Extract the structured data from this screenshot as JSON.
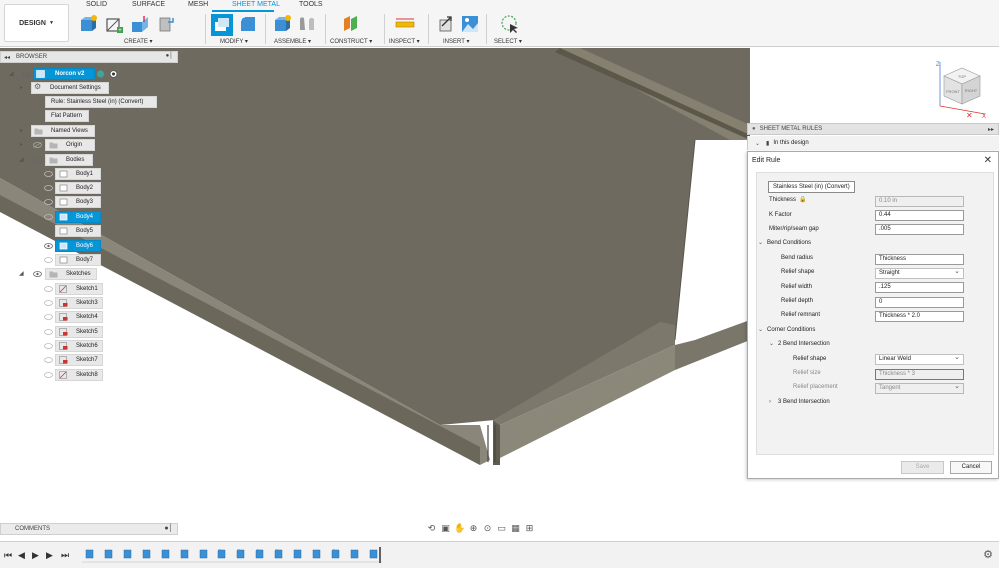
{
  "toolbar": {
    "design_label": "DESIGN",
    "tabs": [
      "SOLID",
      "SURFACE",
      "MESH",
      "SHEET METAL",
      "TOOLS"
    ],
    "groups": [
      "CREATE ▾",
      "MODIFY ▾",
      "ASSEMBLE ▾",
      "CONSTRUCT ▾",
      "INSPECT ▾",
      "INSERT ▾",
      "SELECT ▾"
    ]
  },
  "browser": {
    "title": "BROWSER",
    "root": "Norcon v2",
    "items": [
      {
        "label": "Document Settings"
      },
      {
        "label": "Rule: Stainless Steel (in) (Convert)"
      },
      {
        "label": "Flat Pattern"
      },
      {
        "label": "Named Views"
      },
      {
        "label": "Origin"
      },
      {
        "label": "Bodies"
      }
    ],
    "bodies": [
      "Body1",
      "Body2",
      "Body3",
      "Body4",
      "Body5",
      "Body6",
      "Body7"
    ],
    "sketches_label": "Sketches",
    "sketches": [
      "Sketch1",
      "Sketch3",
      "Sketch4",
      "Sketch5",
      "Sketch6",
      "Sketch7",
      "Sketch8"
    ]
  },
  "comments": {
    "label": "COMMENTS"
  },
  "sheet_metal_rules": {
    "title": "SHEET METAL RULES",
    "section": "In this design"
  },
  "edit_rule": {
    "title": "Edit Rule",
    "rule_name": "Stainless Steel (in) (Convert)",
    "thickness_label": "Thickness",
    "thickness_value": "0.10 in",
    "kfactor_label": "K Factor",
    "kfactor_value": "0.44",
    "gap_label": "Miter/rip/seam gap",
    "gap_value": ".005",
    "bend_conditions": "Bend Conditions",
    "bend_radius_label": "Bend radius",
    "bend_radius_value": "Thickness",
    "relief_shape_label": "Relief shape",
    "relief_shape_value": "Straight",
    "relief_width_label": "Relief width",
    "relief_width_value": ".125",
    "relief_depth_label": "Relief depth",
    "relief_depth_value": "0",
    "relief_remnant_label": "Relief remnant",
    "relief_remnant_value": "Thickness * 2.0",
    "corner_conditions": "Corner Conditions",
    "two_bend": "2 Bend Intersection",
    "corner_relief_shape_label": "Relief shape",
    "corner_relief_shape_value": "Linear Weld",
    "relief_size_label": "Relief size",
    "relief_size_value": "Thickness * 3",
    "relief_placement_label": "Relief placement",
    "relief_placement_value": "Tangent",
    "three_bend": "3 Bend Intersection",
    "save_label": "Save",
    "cancel_label": "Cancel"
  },
  "viewcube": {
    "top": "TOP",
    "front": "FRONT",
    "right": "RIGHT",
    "axis_x": "X",
    "axis_z": "Z"
  },
  "colors": {
    "accent": "#0696d7",
    "sheet_top": "#6f6a5f",
    "sheet_side": "#8a8679"
  }
}
